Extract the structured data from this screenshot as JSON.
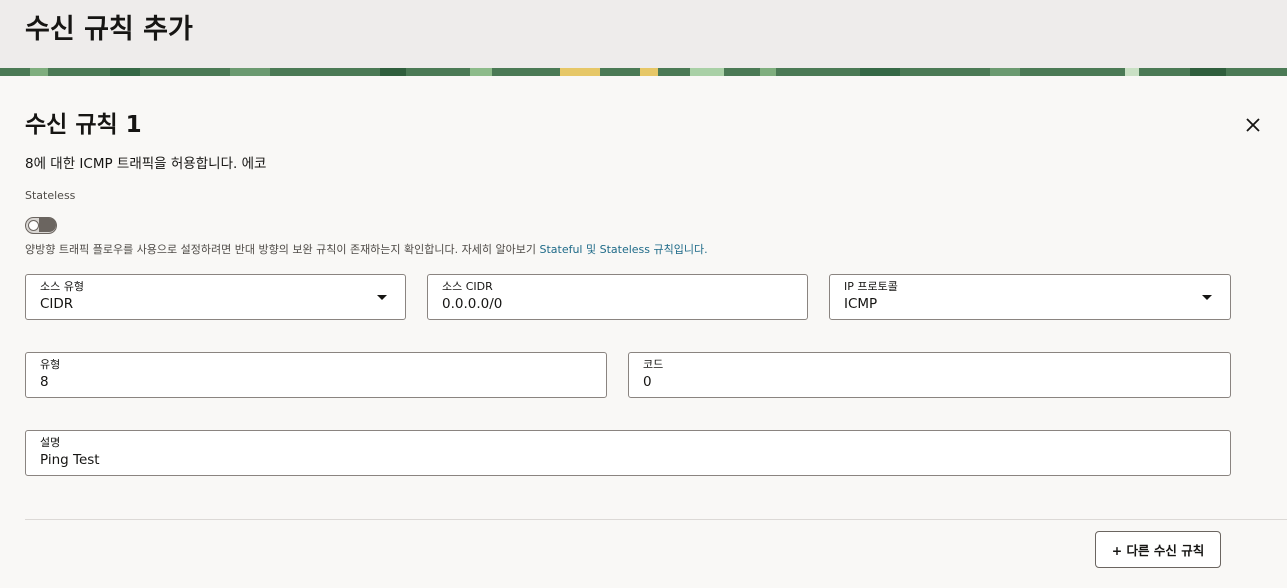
{
  "header": {
    "title": "수신 규칙 추가"
  },
  "rule": {
    "title": "수신 규칙 1",
    "subtitle": "8에 대한 ICMP 트래픽을 허용합니다. 에코",
    "stateless_label": "Stateless",
    "stateless_enabled": false,
    "help_text": "양방향 트래픽 플로우를 사용으로 설정하려면 반대 방향의 보완 규칙이 존재하는지 확인합니다. 자세히 알아보기 ",
    "help_link": "Stateful 및 Stateless 규칙입니다."
  },
  "fields": {
    "source_type": {
      "label": "소스 유형",
      "value": "CIDR"
    },
    "source_cidr": {
      "label": "소스 CIDR",
      "value": "0.0.0.0/0"
    },
    "ip_protocol": {
      "label": "IP 프로토콜",
      "value": "ICMP"
    },
    "type": {
      "label": "유형",
      "value": "8"
    },
    "code": {
      "label": "코드",
      "value": "0"
    },
    "description": {
      "label": "설명",
      "value": "Ping Test"
    }
  },
  "actions": {
    "add_rule": "+ 다른 수신 규칙"
  },
  "colors": {
    "banner": "#4b7a55",
    "link": "#1e6a88"
  }
}
